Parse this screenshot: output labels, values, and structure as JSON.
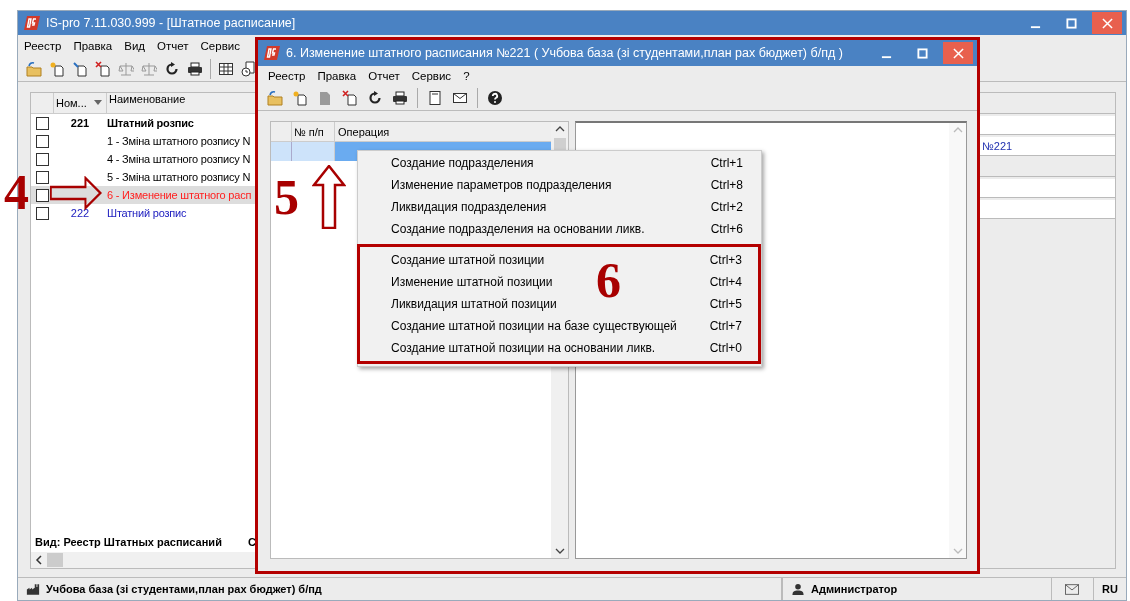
{
  "main_window": {
    "title": "IS-pro 7.11.030.999 - [Штатное расписание]",
    "menu": [
      "Реестр",
      "Правка",
      "Вид",
      "Отчет",
      "Сервис"
    ],
    "table": {
      "columns": [
        "Ном...",
        "Наименование"
      ],
      "rows": [
        {
          "kind": "group",
          "number": "221",
          "name": "Штатний розпис",
          "color": "#000000",
          "checked": false,
          "selected": false
        },
        {
          "kind": "item",
          "name": "1 - Зміна штатного розпису N",
          "color": "#000000",
          "checked": false,
          "selected": false
        },
        {
          "kind": "item",
          "name": "4 - Зміна штатного розпису N",
          "color": "#000000",
          "checked": false,
          "selected": false
        },
        {
          "kind": "item",
          "name": "5 - Зміна штатного розпису N",
          "color": "#000000",
          "checked": false,
          "selected": false
        },
        {
          "kind": "item",
          "name": "6 - Изменение штатного расп",
          "color": "#ff2020",
          "checked": false,
          "selected": true
        },
        {
          "kind": "group_plain",
          "number": "222",
          "name": "Штатний розпис",
          "color": "#2020c0",
          "checked": false,
          "selected": false
        }
      ]
    },
    "view_label": "Вид: Реестр Штатных расписаний",
    "view_label_cut": "С",
    "right_panel_text": "№221"
  },
  "child_window": {
    "title": "6. Изменение штатного расписания №221 ( Учбова база (зі студентами,план рах бюджет) б/пд )",
    "menu": [
      "Реестр",
      "Правка",
      "Отчет",
      "Сервис",
      "?"
    ],
    "grid": {
      "columns": [
        "№ п/п",
        "Операция"
      ]
    }
  },
  "context_menu": {
    "sections": [
      {
        "framed": false,
        "items": [
          {
            "label": "Создание подразделения",
            "shortcut": "Ctrl+1"
          },
          {
            "label": "Изменение параметров подразделения",
            "shortcut": "Ctrl+8"
          },
          {
            "label": "Ликвидация подразделения",
            "shortcut": "Ctrl+2"
          },
          {
            "label": "Создание подразделения на основании ликв.",
            "shortcut": "Ctrl+6"
          }
        ]
      },
      {
        "framed": true,
        "items": [
          {
            "label": "Создание штатной позиции",
            "shortcut": "Ctrl+3"
          },
          {
            "label": "Изменение штатной позиции",
            "shortcut": "Ctrl+4"
          },
          {
            "label": "Ликвидация штатной позиции",
            "shortcut": "Ctrl+5"
          },
          {
            "label": "Создание штатной позиции на базе существующей",
            "shortcut": "Ctrl+7"
          },
          {
            "label": "Создание штатной позиции на основании ликв.",
            "shortcut": "Ctrl+0"
          }
        ]
      }
    ]
  },
  "annotations": [
    {
      "label": "4",
      "kind": "arrow_right"
    },
    {
      "label": "5",
      "kind": "arrow_up"
    },
    {
      "label": "6",
      "kind": "frame"
    }
  ],
  "status_bar": {
    "organization": "Учбова база (зі студентами,план рах бюджет) б/пд",
    "user": "Администратор",
    "language": "RU"
  }
}
